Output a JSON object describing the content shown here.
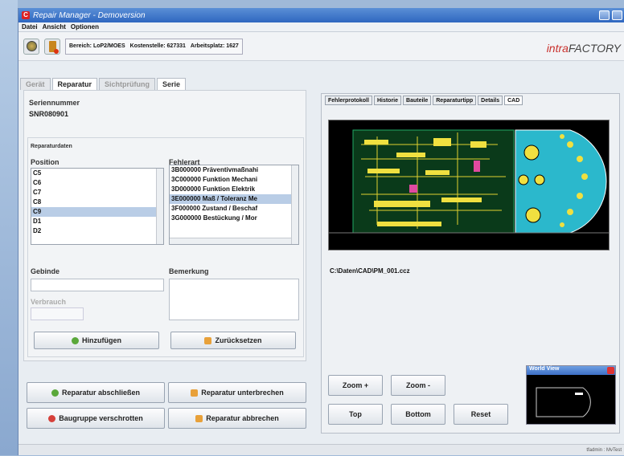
{
  "window": {
    "title": "Repair Manager - Demoversion",
    "logo_letter": "C"
  },
  "menu": [
    "Datei",
    "Ansicht",
    "Optionen"
  ],
  "toolbar": {
    "bereich": "Bereich: LoP2/MOES",
    "kostenstelle": "Kostenstelle: 627331",
    "arbeitsplatz": "Arbeitsplatz: 1627"
  },
  "brand": {
    "prefix": "intra",
    "suffix": "FACTORY"
  },
  "tabs": [
    "Gerät",
    "Reparatur",
    "Sichtprüfung",
    "Serie"
  ],
  "left": {
    "serial_label": "Seriennummer",
    "serial_value": "SNR080901",
    "reparaturdaten_label": "Reparaturdaten",
    "position_label": "Position",
    "positions": [
      "C5",
      "C6",
      "C7",
      "C8",
      "C9",
      "D1",
      "D2"
    ],
    "selected_position": "C9",
    "fehlerart_label": "Fehlerart",
    "fehlerarten": [
      "3B000000   Präventivmaßnahi",
      "3C000000   Funktion Mechani",
      "3D000000   Funktion Elektrik",
      "3E000000   Maß / Toleranz Me",
      "3F000000   Zustand / Beschaf",
      "3G000000   Bestückung / Mor"
    ],
    "selected_fehlerart": "3E000000   Maß / Toleranz Me",
    "gebinde_label": "Gebinde",
    "verbrauch_label": "Verbrauch",
    "bemerkung_label": "Bemerkung",
    "add_label": "Hinzufügen",
    "reset_label": "Zurücksetzen"
  },
  "actions": {
    "complete": "Reparatur abschließen",
    "interrupt": "Reparatur unterbrechen",
    "scrap": "Baugruppe verschrotten",
    "cancel": "Reparatur abbrechen"
  },
  "right": {
    "tabs": [
      "Fehlerprotokoll",
      "Historie",
      "Bauteile",
      "Reparaturtipp",
      "Details",
      "CAD"
    ],
    "active_tab": "CAD",
    "file_path": "C:\\Daten\\CAD\\PM_001.ccz",
    "zoom_in": "Zoom +",
    "zoom_out": "Zoom -",
    "top": "Top",
    "bottom": "Bottom",
    "reset": "Reset",
    "world_view": "World View"
  },
  "status": "tfadmin : MvTest"
}
